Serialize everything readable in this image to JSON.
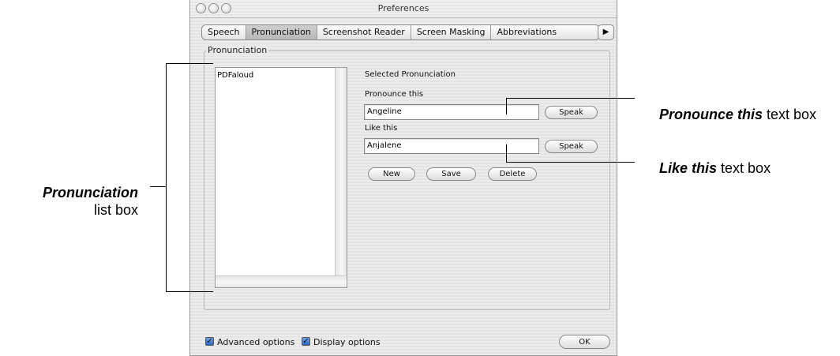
{
  "window": {
    "title": "Preferences"
  },
  "tabs": [
    {
      "label": "Speech",
      "active": false
    },
    {
      "label": "Pronunciation",
      "active": true
    },
    {
      "label": "Screenshot Reader",
      "active": false
    },
    {
      "label": "Screen Masking",
      "active": false
    },
    {
      "label": "Abbreviations",
      "active": false
    }
  ],
  "tab_scroll_icon": "right-arrow-icon",
  "group": {
    "legend": "Pronunciation"
  },
  "pronunciation_list": {
    "items": [
      "PDFaloud"
    ]
  },
  "selected": {
    "heading": "Selected Pronunciation",
    "pronounce_label": "Pronounce this",
    "pronounce_value": "Angeline",
    "like_label": "Like this",
    "like_value": "Anjalene",
    "speak_label": "Speak"
  },
  "actions": {
    "new": "New",
    "save": "Save",
    "delete": "Delete"
  },
  "footer": {
    "advanced_label": "Advanced options",
    "advanced_checked": true,
    "display_label": "Display options",
    "display_checked": true,
    "ok": "OK"
  },
  "annotations": {
    "list_bold": "Pronunciation",
    "list_rest": "list box",
    "pronounce_bold": "Pronounce this",
    "pronounce_rest": " text box",
    "like_bold": "Like this",
    "like_rest": " text box"
  }
}
